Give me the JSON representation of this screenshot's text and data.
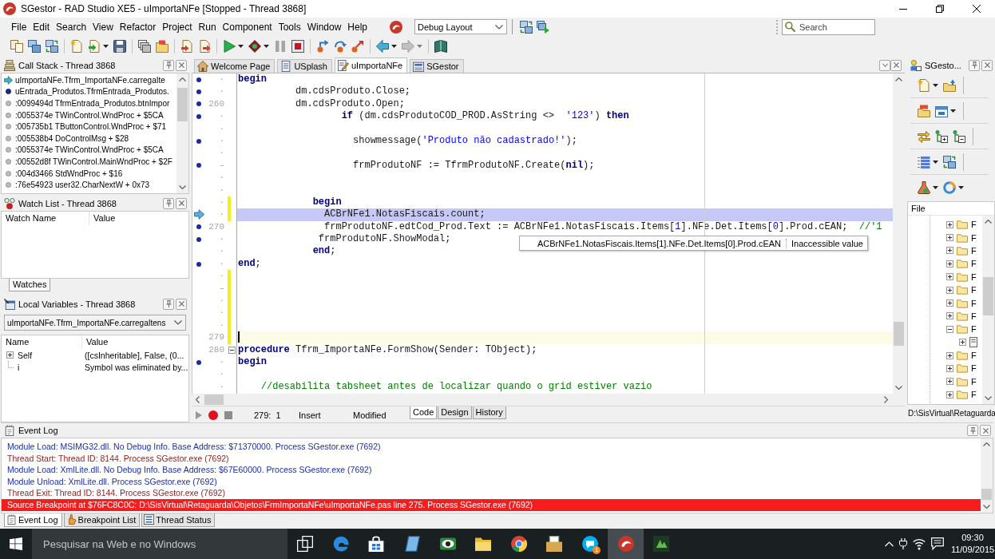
{
  "window": {
    "title": "SGestor - RAD Studio XE5 - uImportaNFe [Stopped - Thread 3868]"
  },
  "menu": [
    "File",
    "Edit",
    "Search",
    "View",
    "Refactor",
    "Project",
    "Run",
    "Component",
    "Tools",
    "Window",
    "Help"
  ],
  "toolbar": {
    "layout": "Debug Layout",
    "layout_buttons": [
      {
        "kind": "windows-swap"
      },
      {
        "kind": "windows-run"
      }
    ],
    "search": {
      "placeholder": "Search"
    },
    "buttons": [
      {
        "kind": "pages",
        "dropdown": false,
        "disabled": false
      },
      {
        "kind": "windows",
        "dropdown": false,
        "disabled": false
      },
      {
        "kind": "windows-swap",
        "dropdown": false,
        "disabled": false
      },
      {
        "kind": "separator"
      },
      {
        "kind": "new-file",
        "dropdown": false,
        "disabled": false
      },
      {
        "kind": "open-file",
        "dropdown": true,
        "disabled": false
      },
      {
        "kind": "save",
        "dropdown": false,
        "disabled": false
      },
      {
        "kind": "separator"
      },
      {
        "kind": "stack",
        "dropdown": false,
        "disabled": false
      },
      {
        "kind": "folder-open",
        "dropdown": false,
        "disabled": false
      },
      {
        "kind": "separator"
      },
      {
        "kind": "import",
        "dropdown": false,
        "disabled": false
      },
      {
        "kind": "export",
        "dropdown": false,
        "disabled": false
      },
      {
        "kind": "separator"
      },
      {
        "kind": "run",
        "dropdown": true,
        "disabled": false
      },
      {
        "kind": "debug-run",
        "dropdown": true,
        "disabled": false
      },
      {
        "kind": "pause",
        "dropdown": false,
        "disabled": true
      },
      {
        "kind": "stop",
        "dropdown": false,
        "disabled": false
      },
      {
        "kind": "separator"
      },
      {
        "kind": "step-into",
        "dropdown": false,
        "disabled": false
      },
      {
        "kind": "step-over",
        "dropdown": false,
        "disabled": false
      },
      {
        "kind": "step-out",
        "dropdown": false,
        "disabled": false
      },
      {
        "kind": "separator"
      },
      {
        "kind": "back",
        "dropdown": true,
        "disabled": false
      },
      {
        "kind": "forward",
        "dropdown": true,
        "disabled": true
      },
      {
        "kind": "separator"
      },
      {
        "kind": "help",
        "dropdown": false,
        "disabled": false
      }
    ]
  },
  "call_stack": {
    "title": "Call Stack - Thread 3868",
    "frames": [
      {
        "text": "uImportaNFe.Tfrm_ImportaNFe.carregaIte",
        "kind": "current"
      },
      {
        "text": "uEntrada_Produtos.TfrmEntrada_Produtos.",
        "kind": "debug"
      },
      {
        "text": ":0099494d TfrmEntrada_Produtos.btnImpor",
        "kind": "nodebug"
      },
      {
        "text": ":0055374e TWinControl.WndProc + $5CA",
        "kind": "nodebug"
      },
      {
        "text": ":005735b1 TButtonControl.WndProc + $71",
        "kind": "nodebug"
      },
      {
        "text": ":005538b4 DoControlMsg + $28",
        "kind": "nodebug"
      },
      {
        "text": ":0055374e TWinControl.WndProc + $5CA",
        "kind": "nodebug"
      },
      {
        "text": ":00552d8f TWinControl.MainWndProc + $2F",
        "kind": "nodebug"
      },
      {
        "text": ":004d3466 StdWndProc + $16",
        "kind": "nodebug"
      },
      {
        "text": ":76e54923 user32.CharNextW + 0x73",
        "kind": "nodebug"
      }
    ]
  },
  "watch_list": {
    "title": "Watch List - Thread 3868",
    "columns": [
      "Watch Name",
      "Value"
    ],
    "tabs": [
      {
        "label": "Watches",
        "selected": true
      }
    ]
  },
  "local_variables": {
    "title": "Local Variables - Thread 3868",
    "scope": "uImportaNFe.Tfrm_ImportaNFe.carregaItens",
    "columns": [
      "Name",
      "Value"
    ],
    "rows": [
      {
        "name": "Self",
        "value": "([csInheritable], False, (0...",
        "expanded": false
      },
      {
        "name": "i",
        "value": "Symbol was eliminated by..."
      }
    ]
  },
  "editor": {
    "tabs": [
      {
        "label": "Welcome Page",
        "kind": "home",
        "selected": false
      },
      {
        "label": "USplash",
        "kind": "unit",
        "selected": false
      },
      {
        "label": "uImportaNFe",
        "kind": "unit-edit",
        "selected": true
      },
      {
        "label": "SGestor",
        "kind": "project",
        "selected": false
      }
    ],
    "lines": [
      {
        "tick": "·",
        "dot": true,
        "modified": false,
        "execution_point": false,
        "caret": false,
        "tokens": [
          {
            "kind": "keyword",
            "text": "begin"
          }
        ]
      },
      {
        "tick": "·",
        "dot": true,
        "modified": false,
        "execution_point": false,
        "caret": false,
        "tokens": [
          {
            "kind": "plain",
            "text": "          dm.cdsProduto.Close;"
          }
        ]
      },
      {
        "number": "260",
        "dot": true,
        "modified": false,
        "execution_point": false,
        "caret": false,
        "tokens": [
          {
            "kind": "plain",
            "text": "          dm.cdsProduto.Open;"
          }
        ]
      },
      {
        "tick": "·",
        "dot": true,
        "modified": false,
        "execution_point": false,
        "caret": false,
        "tokens": [
          {
            "kind": "keyword",
            "text": "                  if"
          },
          {
            "kind": "plain",
            "text": " (dm.cdsProdutoCOD_PROD.AsString <>  "
          },
          {
            "kind": "string",
            "text": "'123'"
          },
          {
            "kind": "plain",
            "text": ") "
          },
          {
            "kind": "keyword",
            "text": "then"
          }
        ]
      },
      {
        "tick": "·",
        "dot": false,
        "modified": false,
        "execution_point": false,
        "caret": false
      },
      {
        "tick": "·",
        "dot": true,
        "modified": false,
        "execution_point": false,
        "caret": false,
        "tokens": [
          {
            "kind": "plain",
            "text": "                    showmessage("
          },
          {
            "kind": "string",
            "text": "'Produto não cadastrado!'"
          },
          {
            "kind": "plain",
            "text": ");"
          }
        ]
      },
      {
        "tick": "·",
        "dot": false,
        "modified": false,
        "execution_point": false,
        "caret": false
      },
      {
        "tick": "–",
        "dot": true,
        "modified": false,
        "execution_point": false,
        "caret": false,
        "tokens": [
          {
            "kind": "plain",
            "text": "                    frmProdutoNF := TfrmProdutoNF.Create("
          },
          {
            "kind": "keyword",
            "text": "nil"
          },
          {
            "kind": "plain",
            "text": ");"
          }
        ]
      },
      {
        "tick": "·",
        "dot": false,
        "modified": false,
        "execution_point": false,
        "caret": false
      },
      {
        "tick": "·",
        "dot": false,
        "modified": false,
        "execution_point": false,
        "caret": false
      },
      {
        "tick": "·",
        "dot": false,
        "modified": true,
        "execution_point": false,
        "caret": false,
        "tokens": [
          {
            "kind": "keyword",
            "text": "             begin"
          }
        ]
      },
      {
        "tick": "·",
        "dot": false,
        "modified": true,
        "execution_point": true,
        "caret": false,
        "tokens": [
          {
            "kind": "plain",
            "text": "               ACBrNFe1.NotasFiscais.count;"
          }
        ]
      },
      {
        "number": "270",
        "dot": true,
        "modified": false,
        "execution_point": false,
        "caret": false,
        "tokens": [
          {
            "kind": "plain",
            "text": "               frmProdutoNF.edtCod_Prod.Text := ACBrNFe1.NotasFiscais.Items["
          },
          {
            "kind": "number",
            "text": "1"
          },
          {
            "kind": "plain",
            "text": "].NFe.Det.Items["
          },
          {
            "kind": "number",
            "text": "0"
          },
          {
            "kind": "plain",
            "text": "].Prod.cEAN;  "
          },
          {
            "kind": "comment",
            "text": "//'1"
          }
        ]
      },
      {
        "tick": "·",
        "dot": true,
        "modified": false,
        "execution_point": false,
        "caret": false,
        "tokens": [
          {
            "kind": "plain",
            "text": "              frmProdutoNF.ShowModal;"
          }
        ]
      },
      {
        "tick": "·",
        "dot": false,
        "modified": false,
        "execution_point": false,
        "caret": false,
        "tokens": [
          {
            "kind": "keyword",
            "text": "             end"
          },
          {
            "kind": "plain",
            "text": ";"
          }
        ]
      },
      {
        "tick": "·",
        "dot": true,
        "modified": false,
        "execution_point": false,
        "caret": false,
        "tokens": [
          {
            "kind": "keyword",
            "text": "end"
          },
          {
            "kind": "plain",
            "text": ";"
          }
        ]
      },
      {
        "tick": "·",
        "dot": false,
        "modified": true,
        "execution_point": false,
        "caret": false
      },
      {
        "tick": "–",
        "dot": false,
        "modified": true,
        "execution_point": false,
        "caret": false
      },
      {
        "tick": "·",
        "dot": false,
        "modified": true,
        "execution_point": false,
        "caret": false
      },
      {
        "tick": "·",
        "dot": false,
        "modified": true,
        "execution_point": false,
        "caret": false
      },
      {
        "tick": "·",
        "dot": false,
        "modified": true,
        "execution_point": false,
        "caret": false
      },
      {
        "number": "279",
        "dot": false,
        "modified": true,
        "execution_point": false,
        "caret": true
      },
      {
        "number": "280",
        "dot": false,
        "modified": false,
        "execution_point": false,
        "caret": false,
        "folded": false,
        "tokens": [
          {
            "kind": "keyword",
            "text": "procedure"
          },
          {
            "kind": "plain",
            "text": " Tfrm_ImportaNFe.FormShow(Sender: TObject);"
          }
        ]
      },
      {
        "tick": "·",
        "dot": true,
        "modified": false,
        "execution_point": false,
        "caret": false,
        "tokens": [
          {
            "kind": "keyword",
            "text": "begin"
          }
        ]
      },
      {
        "tick": "·",
        "dot": false,
        "modified": false,
        "execution_point": false,
        "caret": false
      },
      {
        "tick": "·",
        "dot": false,
        "modified": false,
        "execution_point": false,
        "caret": false,
        "tokens": [
          {
            "kind": "comment",
            "text": "    //desabilita tabsheet antes de localizar quando o grid estiver vazio"
          }
        ]
      }
    ],
    "tooltip": {
      "expression": "ACBrNFe1.NotasFiscais.Items[1].NFe.Det.Items[0].Prod.cEAN",
      "value": "Inaccessible value"
    },
    "status": {
      "position": "279:  1",
      "mode": "Insert",
      "state": "Modified"
    },
    "view_tabs": [
      {
        "label": "Code",
        "selected": true
      },
      {
        "label": "Design",
        "selected": false
      },
      {
        "label": "History",
        "selected": false
      }
    ]
  },
  "project_manager": {
    "title": "SGesto...",
    "toolbar": [
      {
        "buttons": [
          {
            "kind": "new-file",
            "dropdown": true
          },
          {
            "kind": "folder-arrow",
            "dropdown": false
          }
        ]
      },
      {
        "buttons": [
          {
            "kind": "folder-red",
            "dropdown": false
          },
          {
            "kind": "calendar",
            "dropdown": true
          }
        ]
      },
      {
        "buttons": [
          {
            "kind": "swap",
            "dropdown": false
          },
          {
            "kind": "tree-add",
            "dropdown": false
          },
          {
            "kind": "tree-remove",
            "dropdown": false
          }
        ]
      },
      {
        "buttons": [
          {
            "kind": "list",
            "dropdown": true
          },
          {
            "kind": "windows-swap",
            "dropdown": false
          }
        ]
      },
      {
        "buttons": [
          {
            "kind": "paint",
            "dropdown": true
          },
          {
            "kind": "ring",
            "dropdown": true
          }
        ]
      }
    ],
    "tree": {
      "column": "File",
      "items": [
        {
          "label": "F",
          "kind": "folder",
          "expanded": false
        },
        {
          "label": "F",
          "kind": "folder",
          "expanded": false
        },
        {
          "label": "F",
          "kind": "folder",
          "expanded": false
        },
        {
          "label": "F",
          "kind": "folder",
          "expanded": false
        },
        {
          "label": "F",
          "kind": "folder",
          "expanded": false
        },
        {
          "label": "F",
          "kind": "folder",
          "expanded": false
        },
        {
          "label": "F",
          "kind": "folder",
          "expanded": false
        },
        {
          "label": "F",
          "kind": "folder",
          "expanded": false
        },
        {
          "label": "F",
          "kind": "folder",
          "expanded": true,
          "children": [
            {
              "kind": "form",
              "expanded": false
            }
          ]
        },
        {
          "label": "F",
          "kind": "folder",
          "expanded": false
        },
        {
          "label": "F",
          "kind": "folder",
          "expanded": false
        },
        {
          "label": "F",
          "kind": "folder",
          "expanded": false
        },
        {
          "label": "F",
          "kind": "folder",
          "expanded": false
        }
      ]
    },
    "path": "D:\\SisVirtual\\Retaguarda"
  },
  "event_log": {
    "title": "Event Log",
    "entries": [
      {
        "text": "Module Load: MSIMG32.dll. No Debug Info. Base Address: $71370000. Process SGestor.exe (7692)",
        "kind": "module"
      },
      {
        "text": "Thread Start: Thread ID: 8144. Process SGestor.exe (7692)",
        "kind": "thread"
      },
      {
        "text": "Module Load: XmlLite.dll. No Debug Info. Base Address: $67E60000. Process SGestor.exe (7692)",
        "kind": "module"
      },
      {
        "text": "Module Unload: XmlLite.dll. Process SGestor.exe (7692)",
        "kind": "module"
      },
      {
        "text": "Thread Exit: Thread ID: 8144. Process SGestor.exe (7692)",
        "kind": "thread"
      },
      {
        "text": "Source Breakpoint at $76FC8C0C: D:\\SisVirtual\\Retaguarda\\Objetos\\FrmImportaNFe\\uImportaNFe.pas line 275. Process SGestor.exe (7692)",
        "kind": "breakpoint"
      }
    ]
  },
  "bottom_tabs": [
    {
      "label": "Event Log",
      "kind": "log",
      "selected": true
    },
    {
      "label": "Breakpoint List",
      "kind": "breakpoints",
      "selected": false
    },
    {
      "label": "Thread Status",
      "kind": "threads",
      "selected": false
    }
  ],
  "taskbar": {
    "search": {
      "placeholder": "Pesquisar na Web e no Windows"
    },
    "apps": [
      {
        "kind": "task-view",
        "active": false
      },
      {
        "kind": "edge",
        "active": false
      },
      {
        "kind": "store",
        "active": false
      },
      {
        "kind": "tablet",
        "active": false
      },
      {
        "kind": "eye",
        "active": false
      },
      {
        "kind": "explorer",
        "active": false
      },
      {
        "kind": "chrome",
        "active": false
      },
      {
        "kind": "files",
        "active": false
      },
      {
        "kind": "skype",
        "active": false,
        "badge": "1"
      },
      {
        "kind": "rad",
        "active": true
      },
      {
        "kind": "app",
        "active": false
      }
    ],
    "clock": {
      "time": "09:30",
      "date": "11/09/2015"
    }
  }
}
